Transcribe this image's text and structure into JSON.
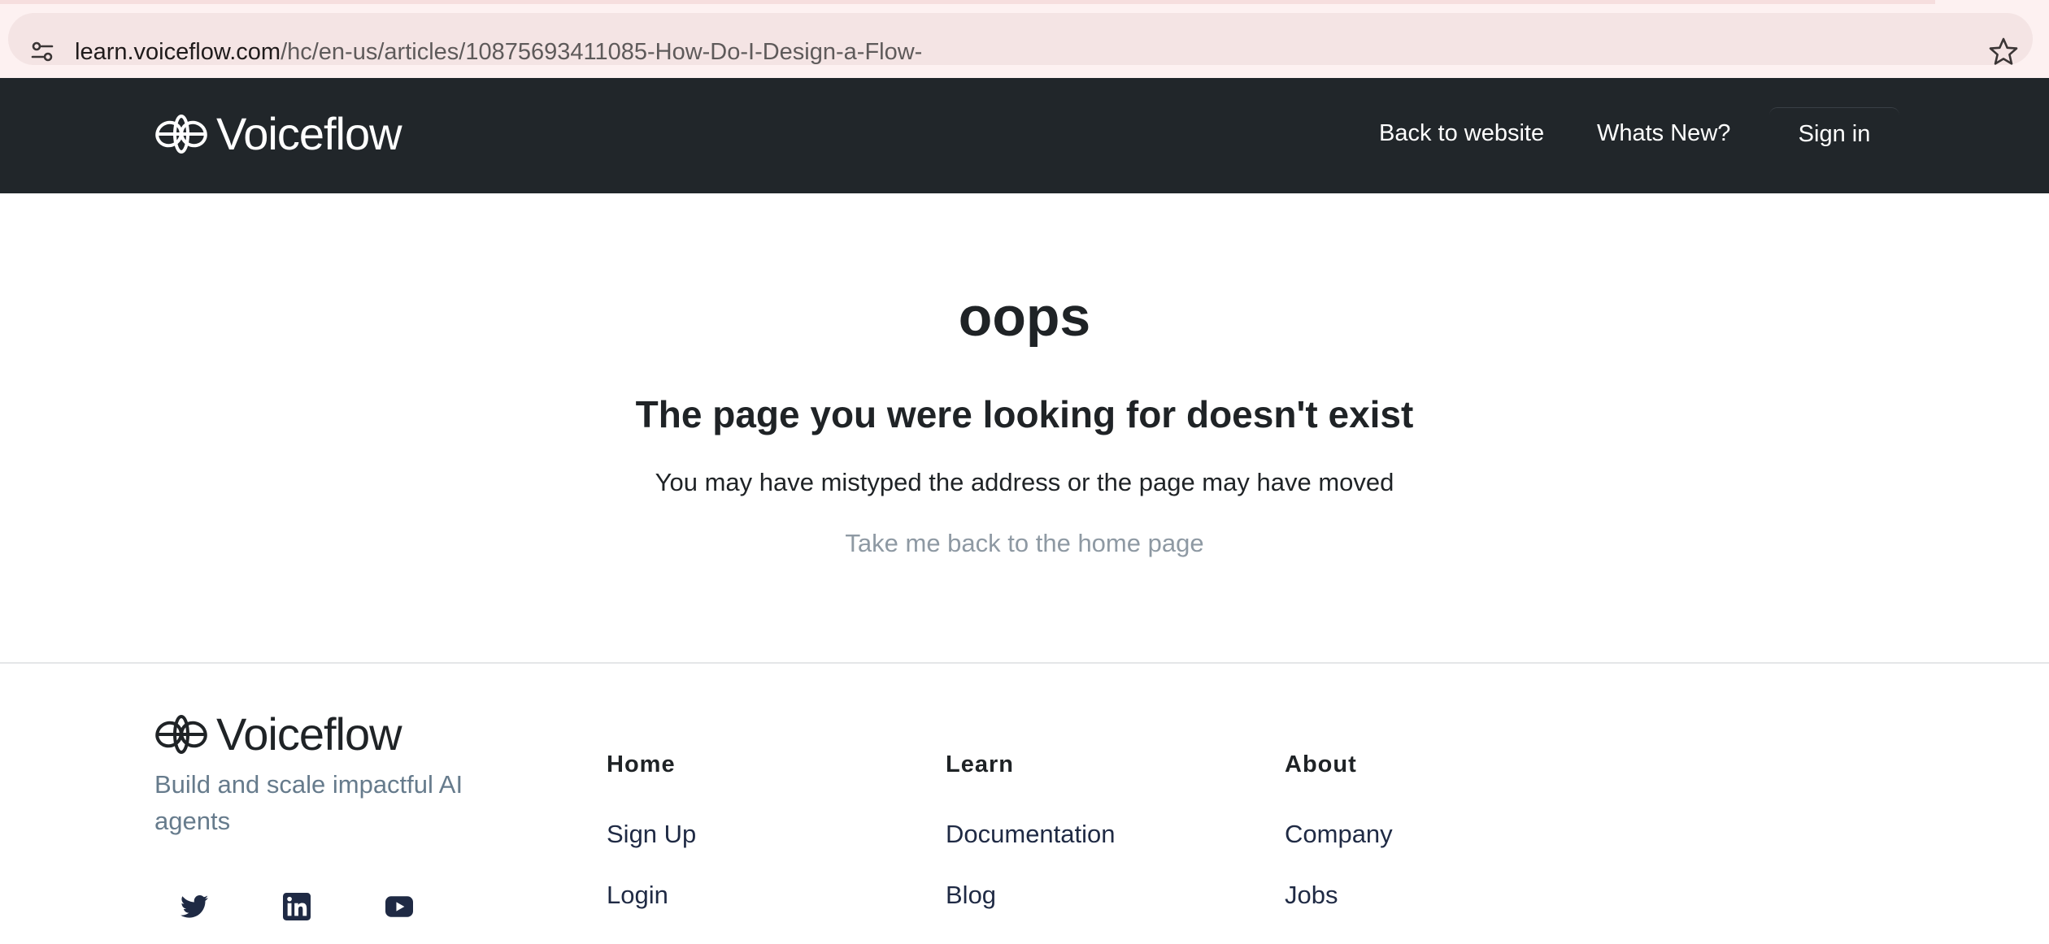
{
  "browser": {
    "url_host": "learn.voiceflow.com",
    "url_path": "/hc/en-us/articles/10875693411085-How-Do-I-Design-a-Flow-",
    "icons": {
      "site_info": "tune-icon",
      "bookmark": "star-icon"
    }
  },
  "header": {
    "logo_text": "Voiceflow",
    "nav": {
      "back": "Back to website",
      "news": "Whats New?",
      "sign_in": "Sign in"
    }
  },
  "main": {
    "title": "oops",
    "heading": "The page you were looking for doesn't exist",
    "subtext": "You may have mistyped the address or the page may have moved",
    "home_link": "Take me back to the home page"
  },
  "footer": {
    "logo_text": "Voiceflow",
    "tagline": "Build and scale impactful AI agents",
    "columns": [
      {
        "title": "Home",
        "links": [
          "Sign Up",
          "Login"
        ]
      },
      {
        "title": "Learn",
        "links": [
          "Documentation",
          "Blog"
        ]
      },
      {
        "title": "About",
        "links": [
          "Company",
          "Jobs"
        ]
      }
    ],
    "socials": [
      "twitter-icon",
      "linkedin-icon",
      "youtube-icon"
    ]
  },
  "colors": {
    "header_bg": "#21262a",
    "text_dark": "#1f2326",
    "link_muted": "#8e99a3",
    "tagline": "#667b8c",
    "chrome_bg": "#fdf1f1"
  }
}
